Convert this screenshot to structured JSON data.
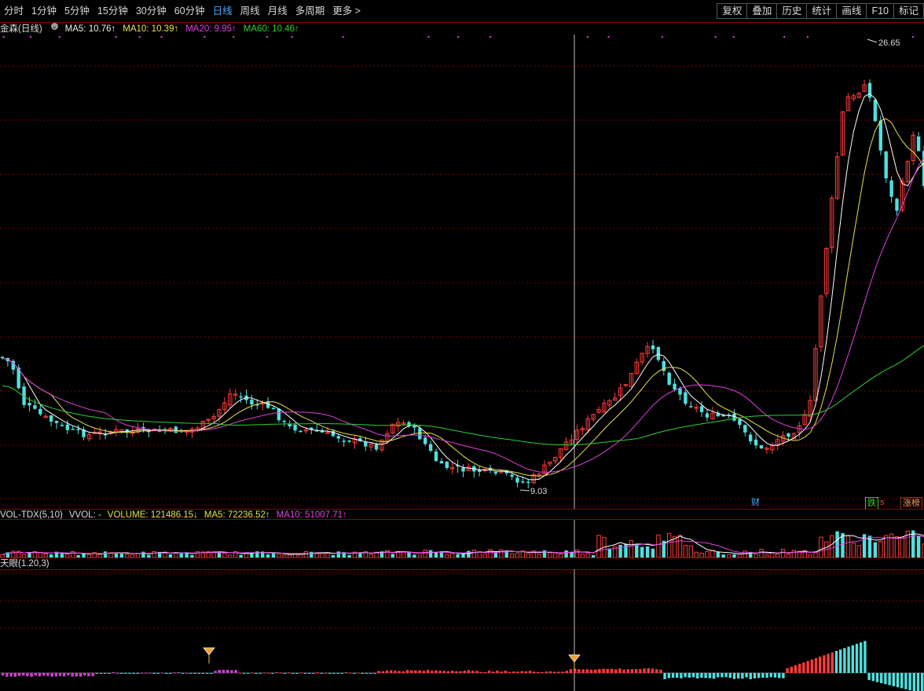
{
  "toolbar": {
    "periods": [
      "分时",
      "1分钟",
      "5分钟",
      "15分钟",
      "30分钟",
      "60分钟",
      "日线",
      "周线",
      "月线",
      "多周期",
      "更多 >"
    ],
    "active_index": 6,
    "right_buttons": [
      "复权",
      "叠加",
      "历史",
      "统计",
      "画线",
      "F10",
      "标记"
    ]
  },
  "main_legend": {
    "stock": "金森(日线)",
    "ma5": "MA5: 10.76↑",
    "ma10": "MA10: 10.39↑",
    "ma20": "MA20: 9.95↑",
    "ma60": "MA60: 10.46↑"
  },
  "colors": {
    "up": "#ff3b3b",
    "down": "#4fe0e0",
    "ma5": "#ffffff",
    "ma10": "#e8e04a",
    "ma20": "#e040e0",
    "ma60": "#30d030",
    "grid": "#7a0000"
  },
  "annotations": {
    "high": "26.65",
    "low": "9.03",
    "badge_cai": "财",
    "badge_die": "跌",
    "badge_s": "s",
    "badge_zhangbang": "涨榜"
  },
  "vol_legend": {
    "name": "VOL-TDX(5,10)",
    "vvol": "VVOL: -",
    "volume": "VOLUME: 121486.15↓",
    "ma5": "MA5: 72236.52↑",
    "ma10": "MA10: 51007.71↑"
  },
  "ind_legend": {
    "name": "天眼(1.20,3)"
  }
}
